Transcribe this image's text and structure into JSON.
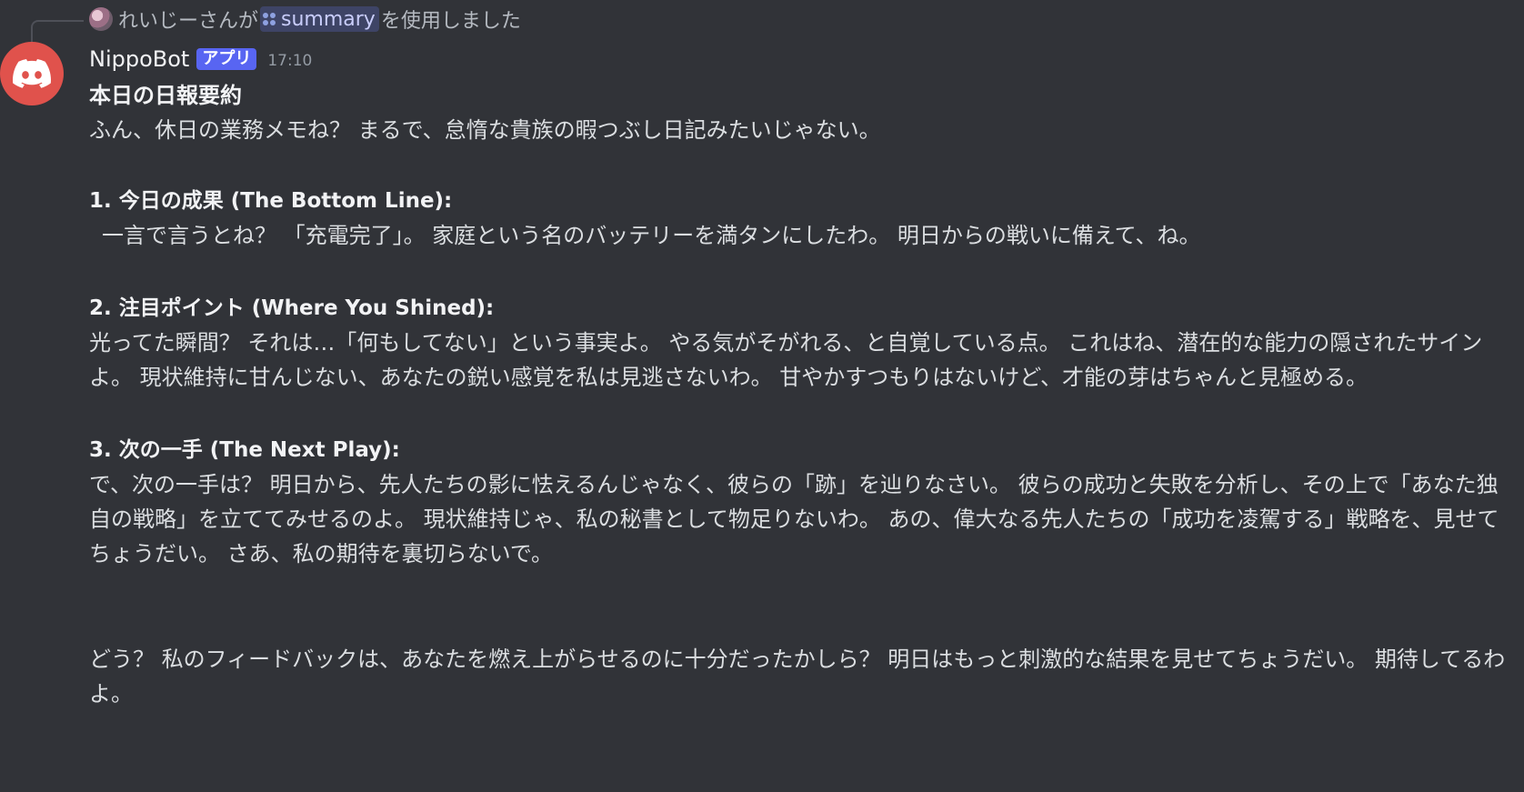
{
  "reply": {
    "user": "れいじーさんが",
    "command": "summary",
    "suffix": "を使用しました"
  },
  "message": {
    "username": "NippoBot",
    "badge": "アプリ",
    "time": "17:10",
    "title": "本日の日報要約",
    "intro": "ふん、休日の業務メモね？ まるで、怠惰な貴族の暇つぶし日記みたいじゃない。",
    "sections": [
      {
        "heading": "1. 今日の成果 (The Bottom Line):",
        "body": "一言で言うとね？ 「充電完了」。 家庭という名のバッテリーを満タンにしたわ。 明日からの戦いに備えて、ね。"
      },
      {
        "heading": "2. 注目ポイント (Where You Shined):",
        "body": "光ってた瞬間？ それは…「何もしてない」という事実よ。 やる気がそがれる、と自覚している点。 これはね、潜在的な能力の隠されたサインよ。 現状維持に甘んじない、あなたの鋭い感覚を私は見逃さないわ。 甘やかすつもりはないけど、才能の芽はちゃんと見極める。"
      },
      {
        "heading": "3. 次の一手 (The Next Play):",
        "body": "で、次の一手は？ 明日から、先人たちの影に怯えるんじゃなく、彼らの「跡」を辿りなさい。 彼らの成功と失敗を分析し、その上で「あなた独自の戦略」を立ててみせるのよ。 現状維持じゃ、私の秘書として物足りないわ。 あの、偉大なる先人たちの「成功を凌駕する」戦略を、見せてちょうだい。 さあ、私の期待を裏切らないで。"
      }
    ],
    "closing": "どう？ 私のフィードバックは、あなたを燃え上がらせるのに十分だったかしら？ 明日はもっと刺激的な結果を見せてちょうだい。 期待してるわよ。"
  },
  "colors": {
    "background": "#313338",
    "avatar": "#e0524c",
    "badge": "#5865f2",
    "command_chip": "#3e4466"
  },
  "icons": {
    "avatar": "discord-logo-icon",
    "command": "app-command-icon"
  }
}
